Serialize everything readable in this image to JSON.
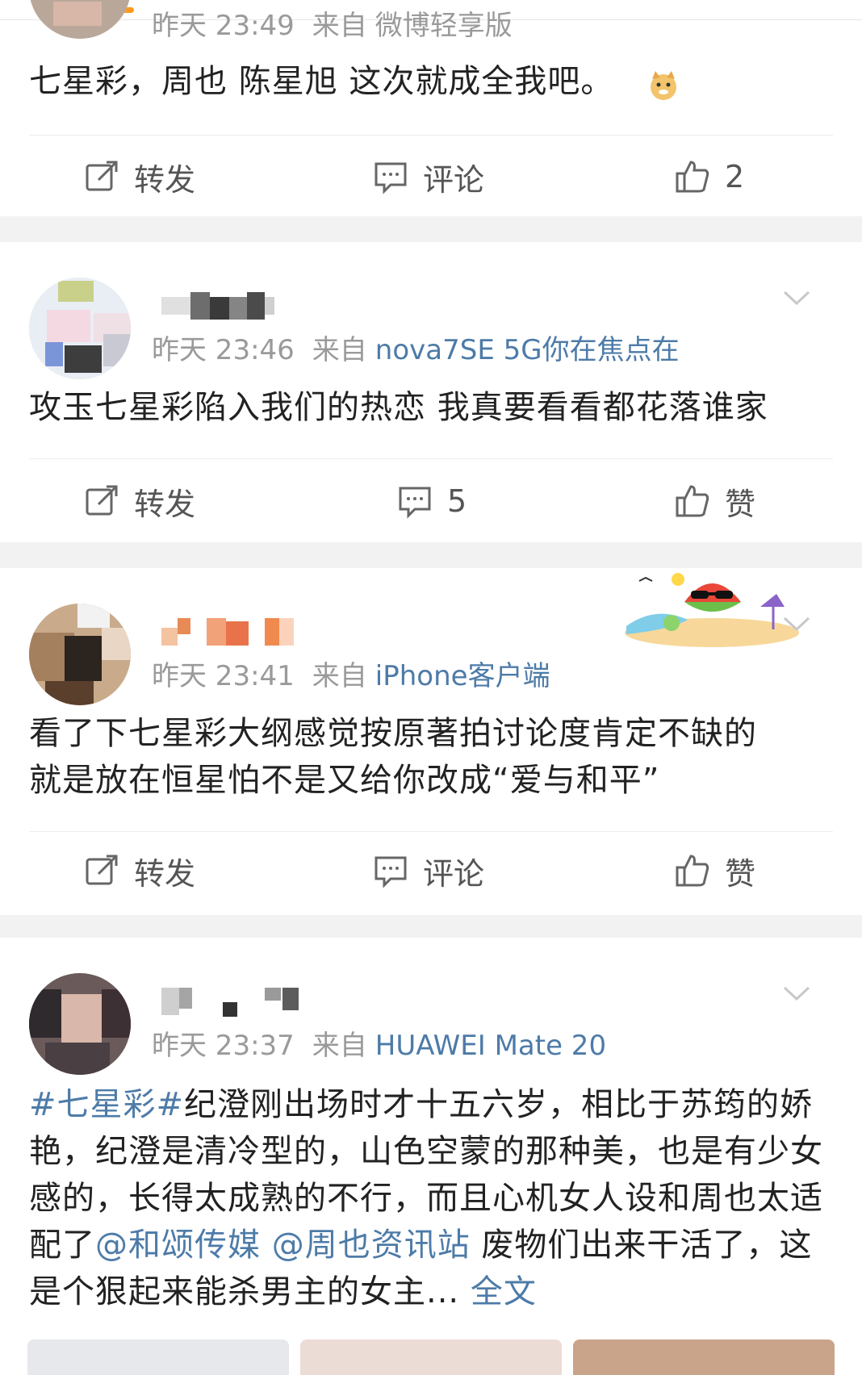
{
  "posts": [
    {
      "time": "昨天 23:49",
      "source_prefix": "来自",
      "device": "微博轻享版",
      "content": "七星彩，周也 陈星旭 这次就成全我吧。",
      "emoji": "doge-emoji",
      "actions": {
        "repost": "转发",
        "comment": "评论",
        "like": "2"
      }
    },
    {
      "time": "昨天 23:46",
      "source_prefix": "来自",
      "device": "nova7SE 5G你在焦点在",
      "content": "攻玉七星彩陷入我们的热恋 我真要看看都花落谁家",
      "actions": {
        "repost": "转发",
        "comment": "5",
        "like": "赞"
      }
    },
    {
      "time": "昨天 23:41",
      "source_prefix": "来自",
      "device": "iPhone客户端",
      "content_line1": "看了下七星彩大纲感觉按原著拍讨论度肯定不缺的",
      "content_line2": "就是放在恒星怕不是又给你改成“爱与和平”",
      "actions": {
        "repost": "转发",
        "comment": "评论",
        "like": "赞"
      }
    },
    {
      "time": "昨天 23:37",
      "source_prefix": "来自",
      "device": "HUAWEI Mate 20",
      "hashtag": "#七星彩#",
      "content_a": "纪澄刚出场时才十五六岁，相比于苏筠的娇艳，纪澄是清冷型的，山色空蒙的那种美，也是有少女感的，长得太成熟的不行，而且心机女人设和周也太适配了",
      "mention1": "@和颂传媒",
      "mention2": "@周也资讯站",
      "content_b": " 废物们出来干活了，这是个狠起来能杀男主的女主...",
      "fulltext": "全文"
    }
  ],
  "icons": {
    "repost": "repost-icon",
    "comment": "comment-icon",
    "like": "thumbs-up-icon",
    "more": "chevron-down-icon"
  },
  "colors": {
    "link": "#4d7ba8",
    "accent": "#ff9a1f",
    "meta": "#9a9a9a"
  }
}
